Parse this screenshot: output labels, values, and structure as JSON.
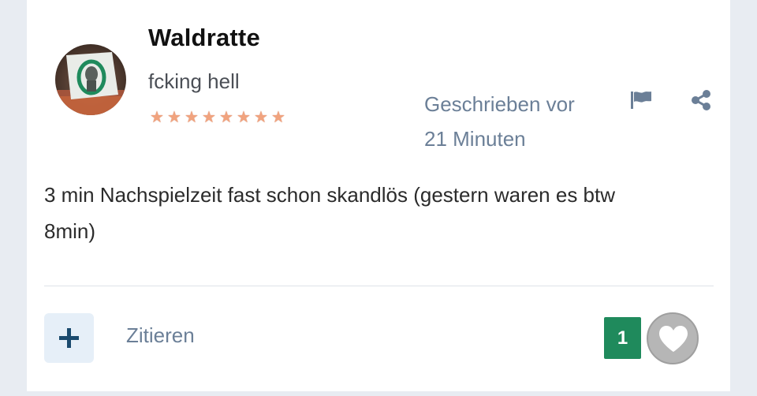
{
  "post": {
    "author": "Waldratte",
    "user_title": "fcking hell",
    "rank_stars": [
      "★",
      "★",
      "★",
      "★",
      "★",
      "★",
      "★",
      "★"
    ],
    "timestamp_line1": "Geschrieben vor",
    "timestamp_line2": "21 Minuten",
    "body_line1": "3 min Nachspielzeit fast schon skandlös (gestern waren es btw",
    "body_line2": "8min)",
    "like_count": "1"
  },
  "actions": {
    "quote_label": "Zitieren"
  },
  "icons": {
    "flag": "flag-icon",
    "share": "share-icon",
    "plus": "plus-icon",
    "heart": "heart-icon"
  },
  "colors": {
    "accent_text": "#6b7f97",
    "like_badge": "#1f8a5c",
    "star": "#f1a37e",
    "plus_button_bg": "#e6eff8",
    "icon_dark": "#1a4a6e"
  }
}
